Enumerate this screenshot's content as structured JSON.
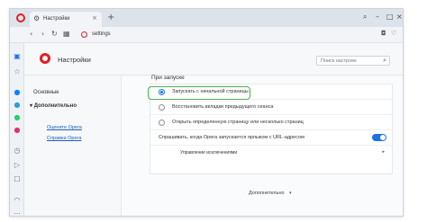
{
  "tab": {
    "title": "Настройки"
  },
  "address": {
    "url": "settings"
  },
  "header": {
    "title": "Настройки",
    "search_placeholder": "Поиск настроек"
  },
  "left_nav": {
    "basic": "Основные",
    "advanced": "Дополнительно",
    "links": [
      "Оцените Opera",
      "Справка Opera"
    ]
  },
  "section": {
    "title": "При запуске",
    "options": [
      {
        "label": "Запускать с начальной страницы",
        "selected": true
      },
      {
        "label": "Восстановить вкладки предыдущего сеанса",
        "selected": false
      },
      {
        "label": "Открыть определенную страницу или несколько страниц",
        "selected": false
      }
    ],
    "toggle_row": {
      "label": "Спрашивать, когда Opera запускается ярлыком с URL-адресом",
      "on": true
    },
    "manage_row": {
      "label": "Управление исключениями"
    }
  },
  "footer": {
    "more_label": "Дополнительно"
  },
  "colors": {
    "opera_red": "#e01f26",
    "accent_blue": "#1c73e8",
    "highlight_green": "#4caf50"
  }
}
